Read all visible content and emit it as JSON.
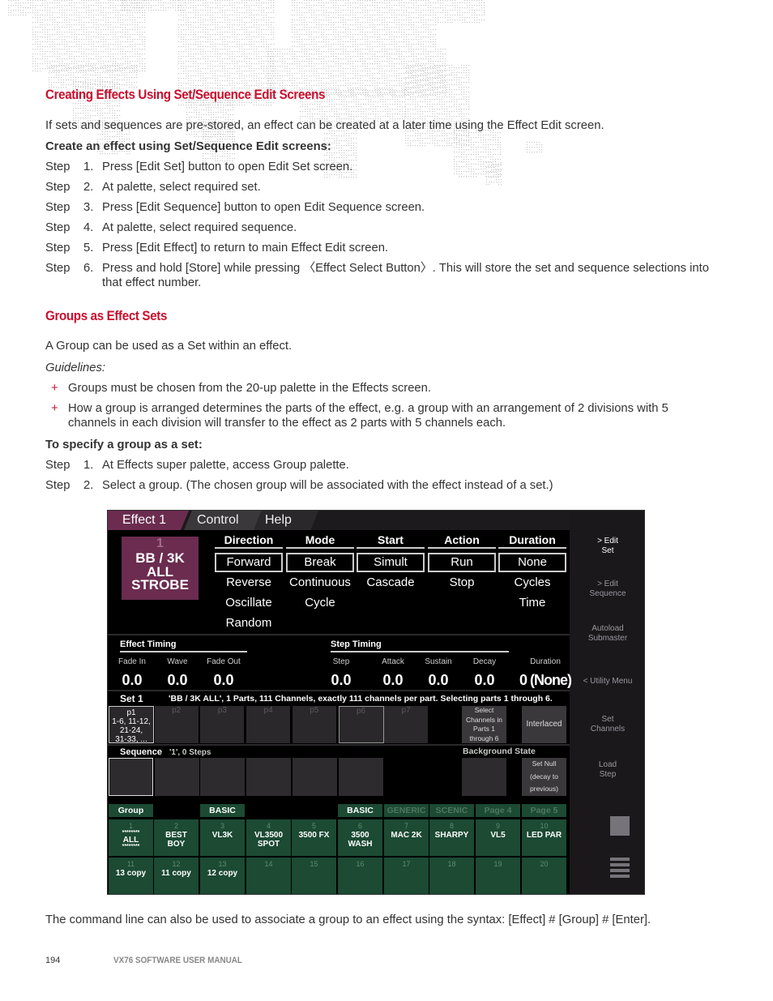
{
  "section1": {
    "heading": "Creating Effects Using Set/Sequence Edit Screens",
    "intro": "If sets and sequences are pre-stored, an effect can be created at a later time using the Effect Edit screen.",
    "procedure_title": "Create an effect using Set/Sequence Edit screens:",
    "steps": [
      {
        "label": "Step",
        "num": "1.",
        "text": "Press [Edit Set] button to open Edit Set screen."
      },
      {
        "label": "Step",
        "num": "2.",
        "text": "At palette, select required set."
      },
      {
        "label": "Step",
        "num": "3.",
        "text": "Press [Edit Sequence] button to open Edit Sequence screen."
      },
      {
        "label": "Step",
        "num": "4.",
        "text": "At palette, select required sequence."
      },
      {
        "label": "Step",
        "num": "5.",
        "text": "Press [Edit Effect] to return to main Effect Edit screen."
      },
      {
        "label": "Step",
        "num": "6.",
        "text": "Press and hold [Store] while pressing 〈Effect Select Button〉. This will store the set and sequence selections into that effect number."
      }
    ]
  },
  "section2": {
    "heading": "Groups as Effect Sets",
    "intro": "A Group can be used as a Set within an effect.",
    "guidelines_label": "Guidelines:",
    "bullet_symbol": "+",
    "bullets": [
      "Groups must be chosen from the 20-up palette in the Effects screen.",
      "How a group is arranged determines the parts of the effect, e.g. a group with an arrangement of 2 divisions with 5 channels in each division will transfer to the effect as 2 parts with 5 channels each."
    ],
    "procedure_title": "To specify a group as a set:",
    "steps": [
      {
        "label": "Step",
        "num": "1.",
        "text": "At Effects super palette, access Group palette."
      },
      {
        "label": "Step",
        "num": "2.",
        "text": "Select a group. (The chosen group will be associated with the effect instead of a set.)"
      }
    ],
    "closing": "The command line can also be used to associate a group to an effect using the syntax: [Effect] # [Group] # [Enter]."
  },
  "footer": {
    "page_number": "194",
    "manual_title": "VX76 SOFTWARE USER MANUAL"
  },
  "console": {
    "tabs": [
      "Effect 1",
      "Control",
      "Help"
    ],
    "effect_badge": {
      "number": "1",
      "line1": "BB / 3K",
      "line2": "ALL",
      "line3": "STROBE"
    },
    "columns": [
      {
        "header": "Direction",
        "selected": "Forward",
        "options": [
          "Reverse",
          "Oscillate",
          "Random"
        ]
      },
      {
        "header": "Mode",
        "selected": "Break",
        "options": [
          "Continuous",
          "Cycle"
        ]
      },
      {
        "header": "Start",
        "selected": "Simult",
        "options": [
          "Cascade"
        ]
      },
      {
        "header": "Action",
        "selected": "Run",
        "options": [
          "Stop"
        ]
      },
      {
        "header": "Duration",
        "selected": "None",
        "options": [
          "Cycles",
          "Time"
        ]
      }
    ],
    "right_menu": [
      {
        "l1": "> Edit",
        "l2": "Set"
      },
      {
        "l1": "> Edit",
        "l2": "Sequence"
      },
      {
        "l1": "Autoload",
        "l2": "Submaster"
      },
      {
        "l1": "< Utility Menu",
        "l2": ""
      },
      {
        "l1": "Set",
        "l2": "Channels"
      },
      {
        "l1": "Load",
        "l2": "Step"
      }
    ],
    "effect_timing": {
      "title": "Effect Timing",
      "fields": [
        {
          "label": "Fade In",
          "value": "0.0"
        },
        {
          "label": "Wave",
          "value": "0.0"
        },
        {
          "label": "Fade Out",
          "value": "0.0"
        }
      ]
    },
    "step_timing": {
      "title": "Step Timing",
      "fields": [
        {
          "label": "Step",
          "value": "0.0"
        },
        {
          "label": "Attack",
          "value": "0.0"
        },
        {
          "label": "Sustain",
          "value": "0.0"
        },
        {
          "label": "Decay",
          "value": "0.0"
        },
        {
          "label": "Duration",
          "value": "0 (None)"
        }
      ]
    },
    "set": {
      "label": "Set 1",
      "description": "'BB / 3K ALL', 1 Parts, 111 Channels, exactly 111 channels per part.   Selecting parts 1 through 6.",
      "parts": [
        {
          "name": "p1",
          "channels": [
            "1-6, 11-12,",
            "21-24,",
            "31-33, ..."
          ]
        },
        {
          "name": "p2"
        },
        {
          "name": "p3"
        },
        {
          "name": "p4"
        },
        {
          "name": "p5"
        },
        {
          "name": "p6"
        },
        {
          "name": "p7"
        }
      ],
      "select_button": [
        "Select",
        "Channels in",
        "Parts 1",
        "through 6"
      ],
      "interlaced_button": "Interlaced"
    },
    "sequence": {
      "label": "Sequence",
      "description": "'1', 0 Steps",
      "background_state_label": "Background State",
      "set_null_button": [
        "Set Null",
        "(decay to",
        "previous)"
      ]
    },
    "group_palette": {
      "tabs": [
        {
          "label": "Group",
          "dim": false
        },
        {
          "label": "BASIC",
          "dim": false
        },
        {
          "label": "BASIC",
          "dim": false
        },
        {
          "label": "GENERIC",
          "dim": true
        },
        {
          "label": "SCENIC",
          "dim": true
        },
        {
          "label": "Page 4",
          "dim": true
        },
        {
          "label": "Page 5",
          "dim": true
        }
      ],
      "cells": [
        {
          "num": "1",
          "l1": "ALL",
          "l2": "",
          "stars": true
        },
        {
          "num": "2",
          "l1": "BEST",
          "l2": "BOY"
        },
        {
          "num": "3",
          "l1": "VL3K",
          "l2": ""
        },
        {
          "num": "4",
          "l1": "VL3500",
          "l2": "SPOT"
        },
        {
          "num": "5",
          "l1": "3500 FX",
          "l2": ""
        },
        {
          "num": "6",
          "l1": "3500",
          "l2": "WASH"
        },
        {
          "num": "7",
          "l1": "MAC 2K",
          "l2": ""
        },
        {
          "num": "8",
          "l1": "SHARPY",
          "l2": ""
        },
        {
          "num": "9",
          "l1": "VL5",
          "l2": ""
        },
        {
          "num": "10",
          "l1": "LED PAR",
          "l2": ""
        },
        {
          "num": "11",
          "l1": "13 copy",
          "l2": ""
        },
        {
          "num": "12",
          "l1": "11 copy",
          "l2": ""
        },
        {
          "num": "13",
          "l1": "12 copy",
          "l2": ""
        },
        {
          "num": "14",
          "l1": "",
          "l2": ""
        },
        {
          "num": "15",
          "l1": "",
          "l2": ""
        },
        {
          "num": "16",
          "l1": "",
          "l2": ""
        },
        {
          "num": "17",
          "l1": "",
          "l2": ""
        },
        {
          "num": "18",
          "l1": "",
          "l2": ""
        },
        {
          "num": "19",
          "l1": "",
          "l2": ""
        },
        {
          "num": "20",
          "l1": "",
          "l2": ""
        }
      ],
      "stars_text": "********"
    }
  }
}
